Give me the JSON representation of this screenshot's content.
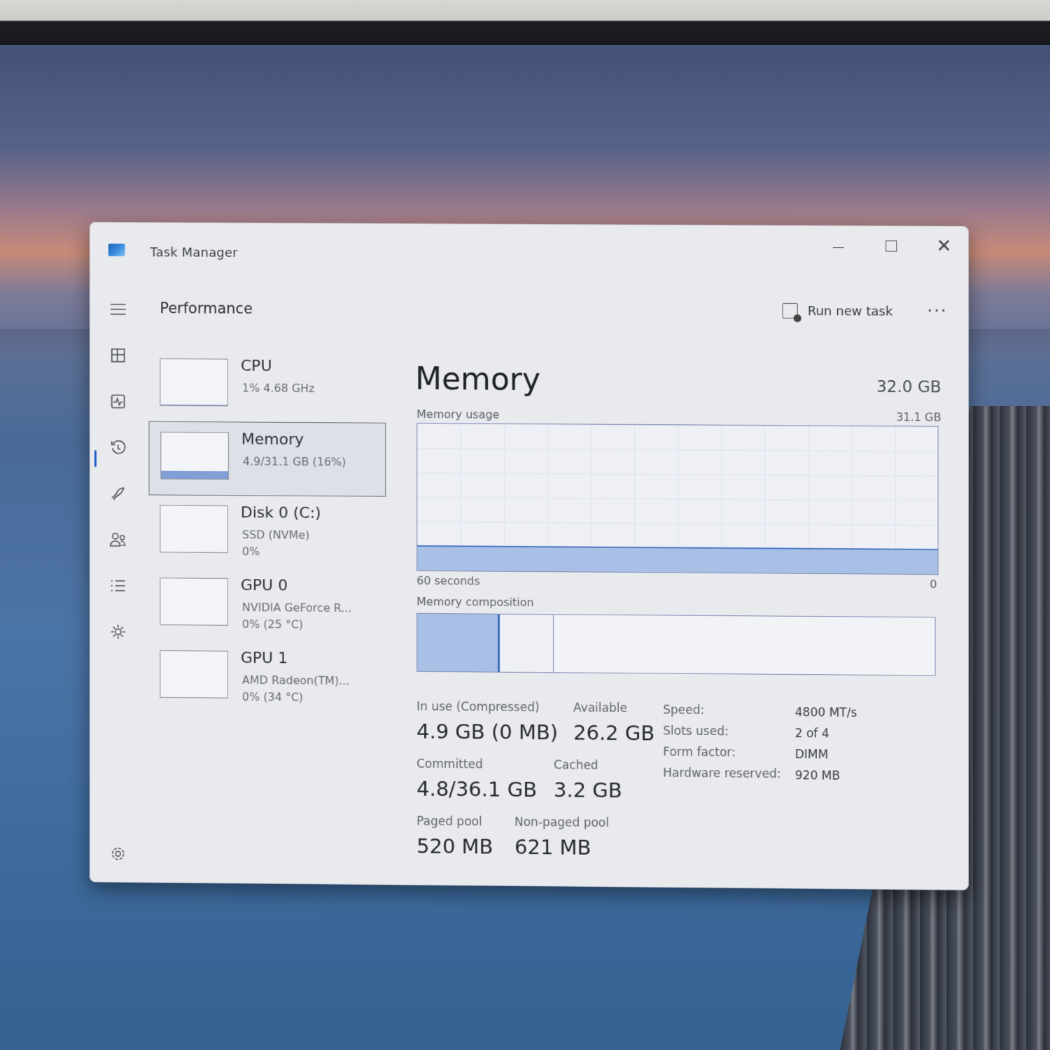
{
  "window": {
    "title": "Task Manager"
  },
  "nav": {
    "items": [
      {
        "icon": "hamburger-menu-icon"
      },
      {
        "icon": "processes-icon"
      },
      {
        "icon": "performance-icon"
      },
      {
        "icon": "app-history-icon"
      },
      {
        "icon": "startup-apps-icon"
      },
      {
        "icon": "users-icon"
      },
      {
        "icon": "details-icon"
      },
      {
        "icon": "services-icon"
      },
      {
        "icon": "settings-icon"
      }
    ],
    "active": "performance-icon"
  },
  "header": {
    "page_title": "Performance",
    "run_new_task": "Run new task",
    "more": "···"
  },
  "devices": [
    {
      "name": "CPU",
      "line1": "1% 4.68 GHz",
      "line2": "",
      "usage": 0.01
    },
    {
      "name": "Memory",
      "line1": "4.9/31.1 GB (16%)",
      "line2": "",
      "usage": 0.16,
      "selected": true
    },
    {
      "name": "Disk 0 (C:)",
      "line1": "SSD (NVMe)",
      "line2": "0%",
      "usage": 0.0
    },
    {
      "name": "GPU 0",
      "line1": "NVIDIA GeForce R...",
      "line2": "0% (25 °C)",
      "usage": 0.0
    },
    {
      "name": "GPU 1",
      "line1": "AMD Radeon(TM)...",
      "line2": "0% (34 °C)",
      "usage": 0.0
    }
  ],
  "memory": {
    "title": "Memory",
    "total": "32.0 GB",
    "usage_label": "Memory usage",
    "usage_max": "31.1 GB",
    "usage_fraction": 0.16,
    "graph_left": "60 seconds",
    "graph_right": "0",
    "composition_label": "Memory composition",
    "composition": {
      "in_use": 0.157,
      "modified": 0.103,
      "standby": 0.74
    },
    "stats": {
      "in_use_label": "In use (Compressed)",
      "in_use_value": "4.9 GB (0 MB)",
      "available_label": "Available",
      "available_value": "26.2 GB",
      "committed_label": "Committed",
      "committed_value": "4.8/36.1 GB",
      "cached_label": "Cached",
      "cached_value": "3.2 GB",
      "paged_label": "Paged pool",
      "paged_value": "520 MB",
      "nonpaged_label": "Non-paged pool",
      "nonpaged_value": "621 MB"
    },
    "info": {
      "speed_key": "Speed:",
      "speed_val": "4800 MT/s",
      "slots_key": "Slots used:",
      "slots_val": "2 of 4",
      "form_key": "Form factor:",
      "form_val": "DIMM",
      "hw_key": "Hardware reserved:",
      "hw_val": "920 MB"
    }
  },
  "colors": {
    "accent": "#1a5fc8",
    "graph_fill": "#a9c0e6",
    "graph_border": "#7f8bb0"
  }
}
